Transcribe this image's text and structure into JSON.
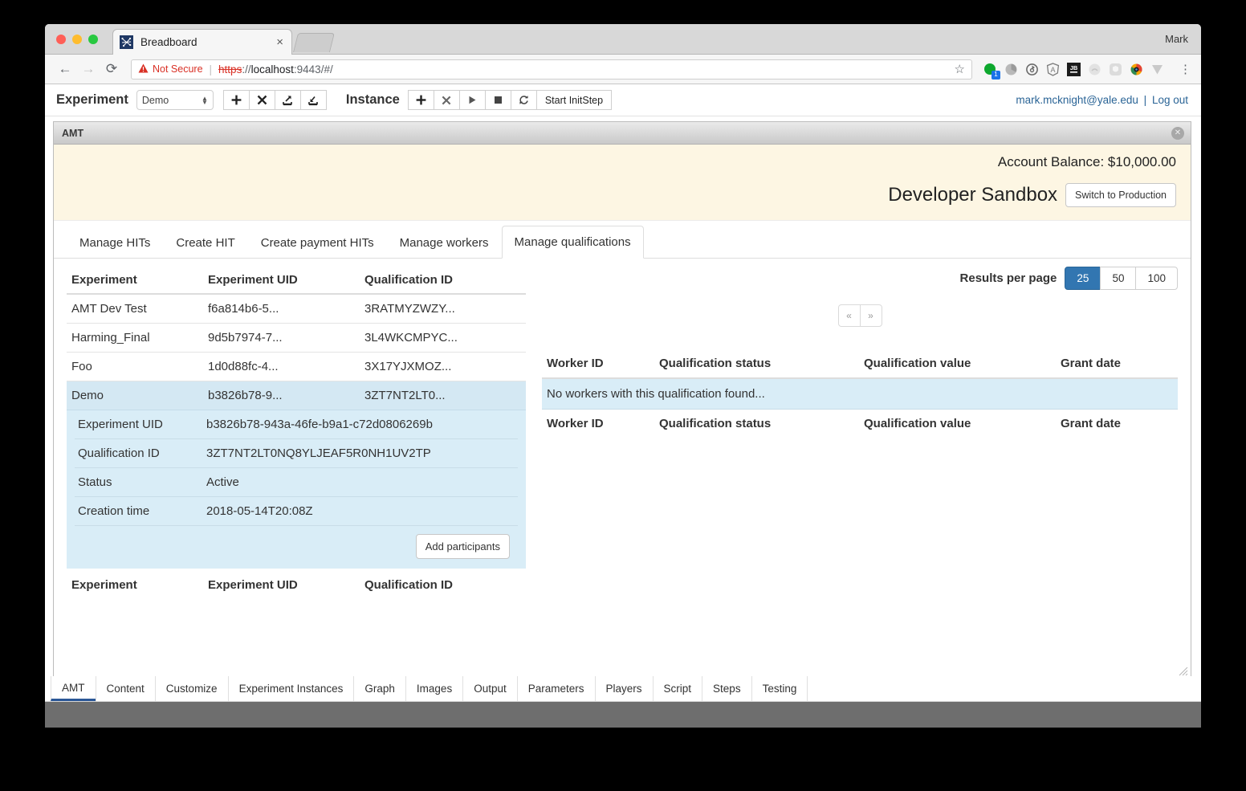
{
  "browser": {
    "tab_title": "Breadboard",
    "tab_close": "×",
    "favicon": "breadboard-icon",
    "profile_name": "Mark",
    "back": "←",
    "forward": "→",
    "reload": "⟳",
    "security_warning": "Not Secure",
    "warning_icon": "⚠",
    "url_scheme": "https",
    "url_separator": "://",
    "url_host": "localhost",
    "url_port": ":9443",
    "url_path": "/#/",
    "star_icon": "☆",
    "menu_icon": "⋮"
  },
  "toolbar": {
    "experiment_label": "Experiment",
    "experiment_value": "Demo",
    "experiment_buttons": [
      {
        "name": "add-experiment-button",
        "glyph": "➕"
      },
      {
        "name": "delete-experiment-button",
        "glyph": "✖"
      },
      {
        "name": "import-experiment-button",
        "glyph": "⤴"
      },
      {
        "name": "export-experiment-button",
        "glyph": "⤵"
      }
    ],
    "instance_label": "Instance",
    "instance_buttons": [
      {
        "name": "add-instance-button",
        "glyph": "➕"
      },
      {
        "name": "delete-instance-button",
        "glyph": "✖"
      },
      {
        "name": "play-instance-button",
        "glyph": "▶"
      },
      {
        "name": "stop-instance-button",
        "glyph": "■"
      },
      {
        "name": "refresh-instance-button",
        "glyph": "↻"
      }
    ],
    "start_init_step": "Start InitStep",
    "user_email": "mark.mcknight@yale.edu",
    "separator": "|",
    "logout": "Log out"
  },
  "panel": {
    "title": "AMT",
    "close_glyph": "✕",
    "account_balance": "Account Balance: $10,000.00",
    "sandbox_title": "Developer Sandbox",
    "switch_button": "Switch to Production"
  },
  "tabs": [
    {
      "label": "Manage HITs",
      "active": false
    },
    {
      "label": "Create HIT",
      "active": false
    },
    {
      "label": "Create payment HITs",
      "active": false
    },
    {
      "label": "Manage workers",
      "active": false
    },
    {
      "label": "Manage qualifications",
      "active": true
    }
  ],
  "qualifications_table": {
    "headers": [
      "Experiment",
      "Experiment UID",
      "Qualification ID"
    ],
    "rows": [
      {
        "experiment": "AMT Dev Test",
        "uid": "f6a814b6-5...",
        "qid": "3RATMYZWZY...",
        "selected": false
      },
      {
        "experiment": "Harming_Final",
        "uid": "9d5b7974-7...",
        "qid": "3L4WKCMPYC...",
        "selected": false
      },
      {
        "experiment": "Foo",
        "uid": "1d0d88fc-4...",
        "qid": "3X17YJXMOZ...",
        "selected": false
      },
      {
        "experiment": "Demo",
        "uid": "b3826b78-9...",
        "qid": "3ZT7NT2LT0...",
        "selected": true
      }
    ],
    "footers": [
      "Experiment",
      "Experiment UID",
      "Qualification ID"
    ]
  },
  "detail": {
    "rows": [
      {
        "key": "Experiment UID",
        "value": "b3826b78-943a-46fe-b9a1-c72d0806269b"
      },
      {
        "key": "Qualification ID",
        "value": "3ZT7NT2LT0NQ8YLJEAF5R0NH1UV2TP"
      },
      {
        "key": "Status",
        "value": "Active"
      },
      {
        "key": "Creation time",
        "value": "2018-05-14T20:08Z"
      }
    ],
    "add_participants": "Add participants"
  },
  "results": {
    "per_page_label": "Results per page",
    "options": [
      "25",
      "50",
      "100"
    ],
    "selected": "25",
    "prev_glyph": "«",
    "next_glyph": "»",
    "accent_color": "#3276b1"
  },
  "workers_table": {
    "headers": [
      "Worker ID",
      "Qualification status",
      "Qualification value",
      "Grant date"
    ],
    "empty_message": "No workers with this qualification found...",
    "footers": [
      "Worker ID",
      "Qualification status",
      "Qualification value",
      "Grant date"
    ]
  },
  "bottom_tabs": [
    {
      "label": "AMT",
      "active": true
    },
    {
      "label": "Content",
      "active": false
    },
    {
      "label": "Customize",
      "active": false
    },
    {
      "label": "Experiment Instances",
      "active": false
    },
    {
      "label": "Graph",
      "active": false
    },
    {
      "label": "Images",
      "active": false
    },
    {
      "label": "Output",
      "active": false
    },
    {
      "label": "Parameters",
      "active": false
    },
    {
      "label": "Players",
      "active": false
    },
    {
      "label": "Script",
      "active": false
    },
    {
      "label": "Steps",
      "active": false
    },
    {
      "label": "Testing",
      "active": false
    }
  ],
  "extensions": [
    {
      "name": "adblock-extension-icon",
      "badge": "1"
    },
    {
      "name": "pie-chart-extension-icon",
      "badge": ""
    },
    {
      "name": "sync-extension-icon",
      "badge": ""
    },
    {
      "name": "angular-extension-icon",
      "badge": ""
    },
    {
      "name": "jetbrains-extension-icon",
      "badge": ""
    },
    {
      "name": "disabled-extension-icon",
      "badge": ""
    },
    {
      "name": "shield-extension-icon",
      "badge": ""
    },
    {
      "name": "colorwheel-extension-icon",
      "badge": ""
    },
    {
      "name": "v-extension-icon",
      "badge": ""
    }
  ]
}
